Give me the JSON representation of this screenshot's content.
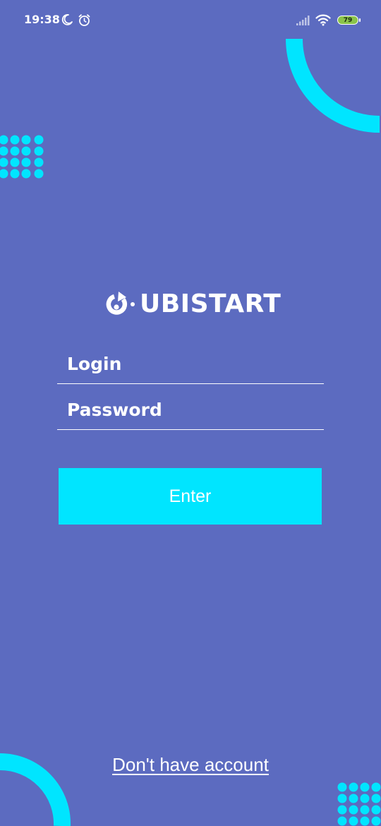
{
  "status_bar": {
    "time": "19:38",
    "battery_level": "79",
    "icons": [
      "moon-icon",
      "alarm-icon",
      "signal-icon",
      "wifi-icon",
      "battery-icon"
    ]
  },
  "logo": {
    "text": "UBISTART",
    "icon": "refresh-logo-icon"
  },
  "form": {
    "login_placeholder": "Login",
    "password_placeholder": "Password",
    "enter_label": "Enter"
  },
  "footer": {
    "signup_link": "Don't have account"
  },
  "colors": {
    "background": "#5c6bc0",
    "accent": "#00e5ff",
    "text": "#ffffff",
    "battery": "#8bc34a"
  }
}
